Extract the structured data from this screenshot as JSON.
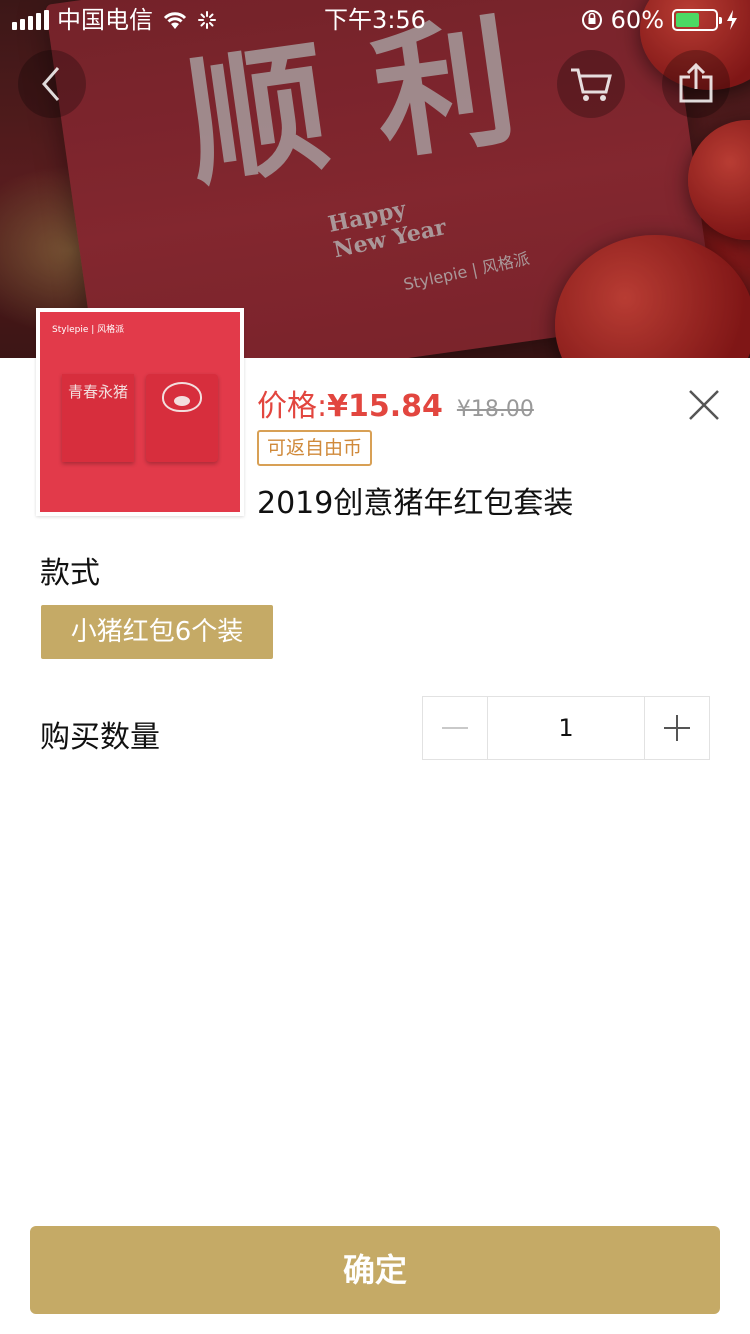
{
  "status_bar": {
    "carrier": "中国电信",
    "time": "下午3:56",
    "battery_percent": "60%",
    "battery_level": 0.6
  },
  "hero": {
    "glyphs": "顺 利",
    "happy_line1": "Happy",
    "happy_line2": "New Year",
    "brand": "Stylepie | 风格派"
  },
  "nav": {
    "back_icon": "chevron-left-icon",
    "cart_icon": "shopping-cart-icon",
    "share_icon": "share-icon"
  },
  "product": {
    "thumb_brand": "Stylepie | 风格派",
    "thumb_envelope_text": "青春永猪",
    "price_label": "价格:",
    "price": "¥15.84",
    "original_price": "¥18.00",
    "badge": "可返自由币",
    "title": "2019创意猪年红包套装"
  },
  "style_section": {
    "label": "款式",
    "options": [
      "小猪红包6个装"
    ],
    "selected": "小猪红包6个装"
  },
  "quantity_section": {
    "label": "购买数量",
    "value": "1"
  },
  "confirm_label": "确定",
  "colors": {
    "accent_gold": "#c5aa66",
    "price_red": "#e2463f",
    "badge_orange": "#d08a3b"
  }
}
